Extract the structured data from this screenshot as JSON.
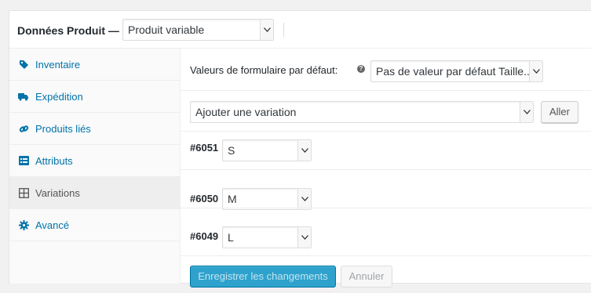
{
  "header": {
    "title": "Données Produit —",
    "product_type": "Produit variable"
  },
  "tabs": [
    {
      "label": "Inventaire",
      "icon": "tag-icon",
      "active": false
    },
    {
      "label": "Expédition",
      "icon": "truck-icon",
      "active": false
    },
    {
      "label": "Produits liés",
      "icon": "link-icon",
      "active": false
    },
    {
      "label": "Attributs",
      "icon": "list-icon",
      "active": false
    },
    {
      "label": "Variations",
      "icon": "grid-icon",
      "active": true
    },
    {
      "label": "Avancé",
      "icon": "gear-icon",
      "active": false
    }
  ],
  "defaults": {
    "label": "Valeurs de formulaire par défaut:",
    "help_icon": "?",
    "value": "Pas de valeur par défaut Taille..."
  },
  "add_variation": {
    "select_value": "Ajouter une variation",
    "go_label": "Aller"
  },
  "variations": [
    {
      "id": "#6051",
      "value": "S"
    },
    {
      "id": "#6050",
      "value": "M"
    },
    {
      "id": "#6049",
      "value": "L"
    }
  ],
  "actions": {
    "save_label": "Enregistrer les changements",
    "cancel_label": "Annuler"
  },
  "colors": {
    "link": "#0073aa",
    "primary": "#2ea2cc"
  }
}
